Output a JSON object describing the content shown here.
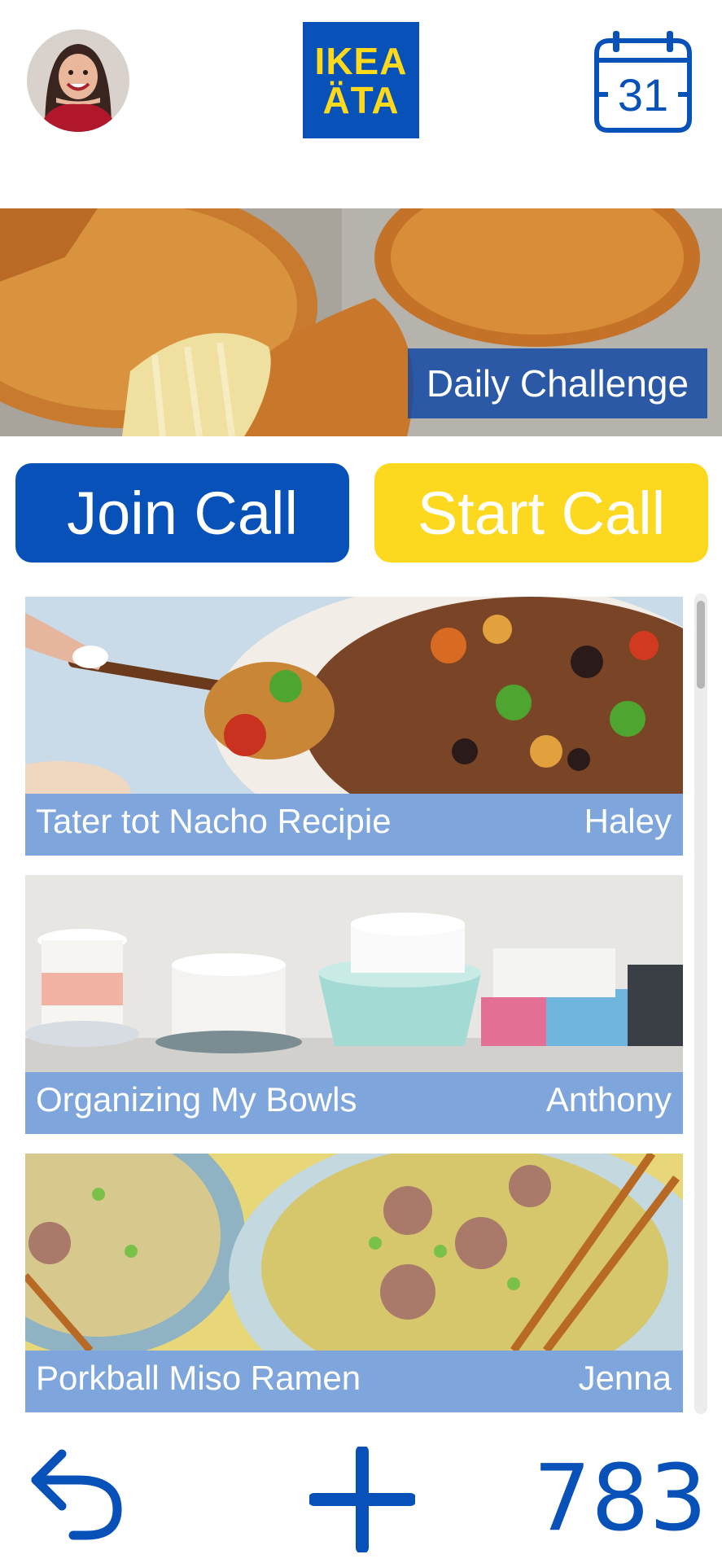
{
  "header": {
    "logo_line1": "IKEA",
    "logo_line2": "ÄTA",
    "calendar_day": "31"
  },
  "banner": {
    "label": "Daily Challenge"
  },
  "actions": {
    "join_label": "Join Call",
    "start_label": "Start Call"
  },
  "feed": [
    {
      "title": "Tater tot Nacho Recipie",
      "author": "Haley"
    },
    {
      "title": "Organizing My Bowls",
      "author": "Anthony"
    },
    {
      "title": "Porkball Miso Ramen",
      "author": "Jenna"
    }
  ],
  "footer": {
    "count": "783"
  },
  "colors": {
    "brand_blue": "#0751b8",
    "brand_yellow": "#fcd81e",
    "card_bar": "#7fa6dc"
  },
  "icons": [
    "avatar",
    "calendar-icon",
    "back-arrow-icon",
    "plus-icon"
  ]
}
